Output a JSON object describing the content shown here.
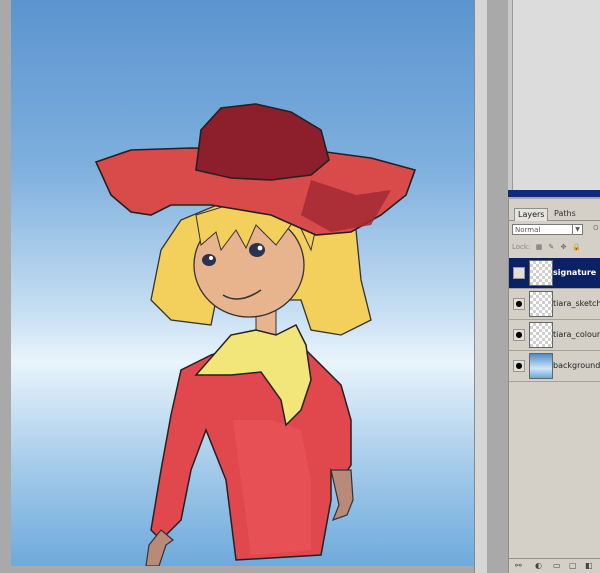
{
  "layers_panel": {
    "tabs": [
      "Layers",
      "Paths"
    ],
    "blend_mode": "Normal",
    "opacity_label": "O",
    "lock_label": "Lock:",
    "layers": [
      {
        "name": "signature",
        "visible": false,
        "selected": true
      },
      {
        "name": "tiara_sketch",
        "visible": true,
        "selected": false
      },
      {
        "name": "tiara_colour",
        "visible": true,
        "selected": false
      },
      {
        "name": "background",
        "visible": true,
        "selected": false
      }
    ]
  },
  "colors": {
    "selection": "#0a2163",
    "hat": "#d94a4a",
    "hat_crown": "#8c1f2b",
    "hair": "#f3cf5b",
    "scarf": "#f2e57a",
    "coat": "#e0484e",
    "skin": "#e8b48e"
  }
}
